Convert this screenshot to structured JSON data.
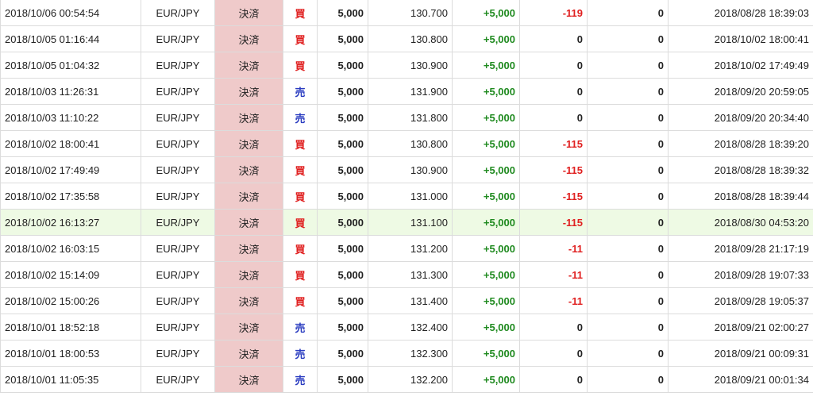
{
  "colors": {
    "buy_side": "#e02020",
    "sell_side": "#2a3cc0",
    "profit_positive": "#1f8a1f",
    "swap_negative": "#e02020",
    "status_cell_bg": "#efcaca",
    "highlighted_row_bg": "#eefae4"
  },
  "rows": [
    {
      "closed_at": "2018/10/06 00:54:54",
      "pair": "EUR/JPY",
      "status": "決済",
      "side": "買",
      "side_type": "buy",
      "qty": "5,000",
      "price": "130.700",
      "pl": "+5,000",
      "swap": "-119",
      "fee": "0",
      "opened_at": "2018/08/28 18:39:03"
    },
    {
      "closed_at": "2018/10/05 01:16:44",
      "pair": "EUR/JPY",
      "status": "決済",
      "side": "買",
      "side_type": "buy",
      "qty": "5,000",
      "price": "130.800",
      "pl": "+5,000",
      "swap": "0",
      "fee": "0",
      "opened_at": "2018/10/02 18:00:41"
    },
    {
      "closed_at": "2018/10/05 01:04:32",
      "pair": "EUR/JPY",
      "status": "決済",
      "side": "買",
      "side_type": "buy",
      "qty": "5,000",
      "price": "130.900",
      "pl": "+5,000",
      "swap": "0",
      "fee": "0",
      "opened_at": "2018/10/02 17:49:49"
    },
    {
      "closed_at": "2018/10/03 11:26:31",
      "pair": "EUR/JPY",
      "status": "決済",
      "side": "売",
      "side_type": "sell",
      "qty": "5,000",
      "price": "131.900",
      "pl": "+5,000",
      "swap": "0",
      "fee": "0",
      "opened_at": "2018/09/20 20:59:05"
    },
    {
      "closed_at": "2018/10/03 11:10:22",
      "pair": "EUR/JPY",
      "status": "決済",
      "side": "売",
      "side_type": "sell",
      "qty": "5,000",
      "price": "131.800",
      "pl": "+5,000",
      "swap": "0",
      "fee": "0",
      "opened_at": "2018/09/20 20:34:40"
    },
    {
      "closed_at": "2018/10/02 18:00:41",
      "pair": "EUR/JPY",
      "status": "決済",
      "side": "買",
      "side_type": "buy",
      "qty": "5,000",
      "price": "130.800",
      "pl": "+5,000",
      "swap": "-115",
      "fee": "0",
      "opened_at": "2018/08/28 18:39:20"
    },
    {
      "closed_at": "2018/10/02 17:49:49",
      "pair": "EUR/JPY",
      "status": "決済",
      "side": "買",
      "side_type": "buy",
      "qty": "5,000",
      "price": "130.900",
      "pl": "+5,000",
      "swap": "-115",
      "fee": "0",
      "opened_at": "2018/08/28 18:39:32"
    },
    {
      "closed_at": "2018/10/02 17:35:58",
      "pair": "EUR/JPY",
      "status": "決済",
      "side": "買",
      "side_type": "buy",
      "qty": "5,000",
      "price": "131.000",
      "pl": "+5,000",
      "swap": "-115",
      "fee": "0",
      "opened_at": "2018/08/28 18:39:44"
    },
    {
      "closed_at": "2018/10/02 16:13:27",
      "pair": "EUR/JPY",
      "status": "決済",
      "side": "買",
      "side_type": "buy",
      "qty": "5,000",
      "price": "131.100",
      "pl": "+5,000",
      "swap": "-115",
      "fee": "0",
      "opened_at": "2018/08/30 04:53:20",
      "highlighted": true
    },
    {
      "closed_at": "2018/10/02 16:03:15",
      "pair": "EUR/JPY",
      "status": "決済",
      "side": "買",
      "side_type": "buy",
      "qty": "5,000",
      "price": "131.200",
      "pl": "+5,000",
      "swap": "-11",
      "fee": "0",
      "opened_at": "2018/09/28 21:17:19"
    },
    {
      "closed_at": "2018/10/02 15:14:09",
      "pair": "EUR/JPY",
      "status": "決済",
      "side": "買",
      "side_type": "buy",
      "qty": "5,000",
      "price": "131.300",
      "pl": "+5,000",
      "swap": "-11",
      "fee": "0",
      "opened_at": "2018/09/28 19:07:33"
    },
    {
      "closed_at": "2018/10/02 15:00:26",
      "pair": "EUR/JPY",
      "status": "決済",
      "side": "買",
      "side_type": "buy",
      "qty": "5,000",
      "price": "131.400",
      "pl": "+5,000",
      "swap": "-11",
      "fee": "0",
      "opened_at": "2018/09/28 19:05:37"
    },
    {
      "closed_at": "2018/10/01 18:52:18",
      "pair": "EUR/JPY",
      "status": "決済",
      "side": "売",
      "side_type": "sell",
      "qty": "5,000",
      "price": "132.400",
      "pl": "+5,000",
      "swap": "0",
      "fee": "0",
      "opened_at": "2018/09/21 02:00:27"
    },
    {
      "closed_at": "2018/10/01 18:00:53",
      "pair": "EUR/JPY",
      "status": "決済",
      "side": "売",
      "side_type": "sell",
      "qty": "5,000",
      "price": "132.300",
      "pl": "+5,000",
      "swap": "0",
      "fee": "0",
      "opened_at": "2018/09/21 00:09:31"
    },
    {
      "closed_at": "2018/10/01 11:05:35",
      "pair": "EUR/JPY",
      "status": "決済",
      "side": "売",
      "side_type": "sell",
      "qty": "5,000",
      "price": "132.200",
      "pl": "+5,000",
      "swap": "0",
      "fee": "0",
      "opened_at": "2018/09/21 00:01:34"
    }
  ]
}
